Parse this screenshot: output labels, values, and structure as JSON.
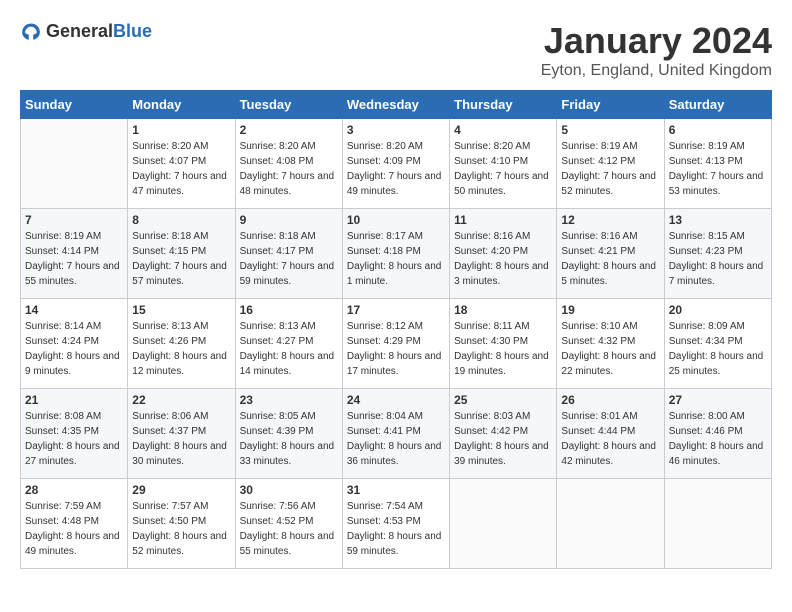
{
  "header": {
    "logo_general": "General",
    "logo_blue": "Blue",
    "month": "January 2024",
    "location": "Eyton, England, United Kingdom"
  },
  "days_of_week": [
    "Sunday",
    "Monday",
    "Tuesday",
    "Wednesday",
    "Thursday",
    "Friday",
    "Saturday"
  ],
  "weeks": [
    [
      {
        "day": "",
        "sunrise": "",
        "sunset": "",
        "daylight": ""
      },
      {
        "day": "1",
        "sunrise": "8:20 AM",
        "sunset": "4:07 PM",
        "daylight": "7 hours and 47 minutes."
      },
      {
        "day": "2",
        "sunrise": "8:20 AM",
        "sunset": "4:08 PM",
        "daylight": "7 hours and 48 minutes."
      },
      {
        "day": "3",
        "sunrise": "8:20 AM",
        "sunset": "4:09 PM",
        "daylight": "7 hours and 49 minutes."
      },
      {
        "day": "4",
        "sunrise": "8:20 AM",
        "sunset": "4:10 PM",
        "daylight": "7 hours and 50 minutes."
      },
      {
        "day": "5",
        "sunrise": "8:19 AM",
        "sunset": "4:12 PM",
        "daylight": "7 hours and 52 minutes."
      },
      {
        "day": "6",
        "sunrise": "8:19 AM",
        "sunset": "4:13 PM",
        "daylight": "7 hours and 53 minutes."
      }
    ],
    [
      {
        "day": "7",
        "sunrise": "8:19 AM",
        "sunset": "4:14 PM",
        "daylight": "7 hours and 55 minutes."
      },
      {
        "day": "8",
        "sunrise": "8:18 AM",
        "sunset": "4:15 PM",
        "daylight": "7 hours and 57 minutes."
      },
      {
        "day": "9",
        "sunrise": "8:18 AM",
        "sunset": "4:17 PM",
        "daylight": "7 hours and 59 minutes."
      },
      {
        "day": "10",
        "sunrise": "8:17 AM",
        "sunset": "4:18 PM",
        "daylight": "8 hours and 1 minute."
      },
      {
        "day": "11",
        "sunrise": "8:16 AM",
        "sunset": "4:20 PM",
        "daylight": "8 hours and 3 minutes."
      },
      {
        "day": "12",
        "sunrise": "8:16 AM",
        "sunset": "4:21 PM",
        "daylight": "8 hours and 5 minutes."
      },
      {
        "day": "13",
        "sunrise": "8:15 AM",
        "sunset": "4:23 PM",
        "daylight": "8 hours and 7 minutes."
      }
    ],
    [
      {
        "day": "14",
        "sunrise": "8:14 AM",
        "sunset": "4:24 PM",
        "daylight": "8 hours and 9 minutes."
      },
      {
        "day": "15",
        "sunrise": "8:13 AM",
        "sunset": "4:26 PM",
        "daylight": "8 hours and 12 minutes."
      },
      {
        "day": "16",
        "sunrise": "8:13 AM",
        "sunset": "4:27 PM",
        "daylight": "8 hours and 14 minutes."
      },
      {
        "day": "17",
        "sunrise": "8:12 AM",
        "sunset": "4:29 PM",
        "daylight": "8 hours and 17 minutes."
      },
      {
        "day": "18",
        "sunrise": "8:11 AM",
        "sunset": "4:30 PM",
        "daylight": "8 hours and 19 minutes."
      },
      {
        "day": "19",
        "sunrise": "8:10 AM",
        "sunset": "4:32 PM",
        "daylight": "8 hours and 22 minutes."
      },
      {
        "day": "20",
        "sunrise": "8:09 AM",
        "sunset": "4:34 PM",
        "daylight": "8 hours and 25 minutes."
      }
    ],
    [
      {
        "day": "21",
        "sunrise": "8:08 AM",
        "sunset": "4:35 PM",
        "daylight": "8 hours and 27 minutes."
      },
      {
        "day": "22",
        "sunrise": "8:06 AM",
        "sunset": "4:37 PM",
        "daylight": "8 hours and 30 minutes."
      },
      {
        "day": "23",
        "sunrise": "8:05 AM",
        "sunset": "4:39 PM",
        "daylight": "8 hours and 33 minutes."
      },
      {
        "day": "24",
        "sunrise": "8:04 AM",
        "sunset": "4:41 PM",
        "daylight": "8 hours and 36 minutes."
      },
      {
        "day": "25",
        "sunrise": "8:03 AM",
        "sunset": "4:42 PM",
        "daylight": "8 hours and 39 minutes."
      },
      {
        "day": "26",
        "sunrise": "8:01 AM",
        "sunset": "4:44 PM",
        "daylight": "8 hours and 42 minutes."
      },
      {
        "day": "27",
        "sunrise": "8:00 AM",
        "sunset": "4:46 PM",
        "daylight": "8 hours and 46 minutes."
      }
    ],
    [
      {
        "day": "28",
        "sunrise": "7:59 AM",
        "sunset": "4:48 PM",
        "daylight": "8 hours and 49 minutes."
      },
      {
        "day": "29",
        "sunrise": "7:57 AM",
        "sunset": "4:50 PM",
        "daylight": "8 hours and 52 minutes."
      },
      {
        "day": "30",
        "sunrise": "7:56 AM",
        "sunset": "4:52 PM",
        "daylight": "8 hours and 55 minutes."
      },
      {
        "day": "31",
        "sunrise": "7:54 AM",
        "sunset": "4:53 PM",
        "daylight": "8 hours and 59 minutes."
      },
      {
        "day": "",
        "sunrise": "",
        "sunset": "",
        "daylight": ""
      },
      {
        "day": "",
        "sunrise": "",
        "sunset": "",
        "daylight": ""
      },
      {
        "day": "",
        "sunrise": "",
        "sunset": "",
        "daylight": ""
      }
    ]
  ],
  "labels": {
    "sunrise": "Sunrise:",
    "sunset": "Sunset:",
    "daylight": "Daylight:"
  }
}
